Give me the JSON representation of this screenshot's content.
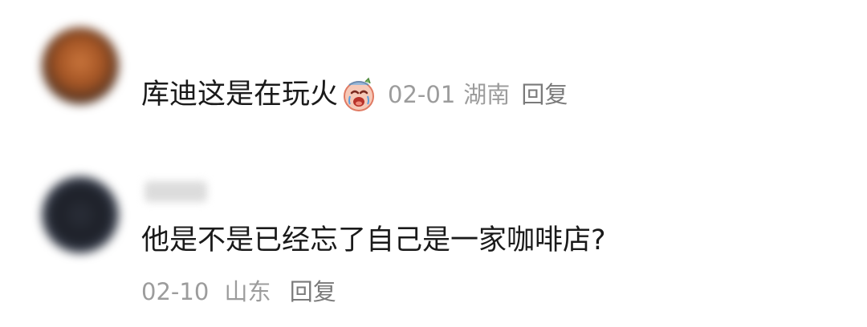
{
  "comments": [
    {
      "text": "库迪这是在玩火",
      "emoji_icon": "crying-face-icon",
      "date": "02-01",
      "location": "湖南",
      "reply_label": "回复"
    },
    {
      "text": "他是不是已经忘了自己是一家咖啡店?",
      "date": "02-10",
      "location": "山东",
      "reply_label": "回复"
    }
  ],
  "colors": {
    "text": "#1a1a1a",
    "meta": "#9c9c9c",
    "background": "#ffffff"
  }
}
